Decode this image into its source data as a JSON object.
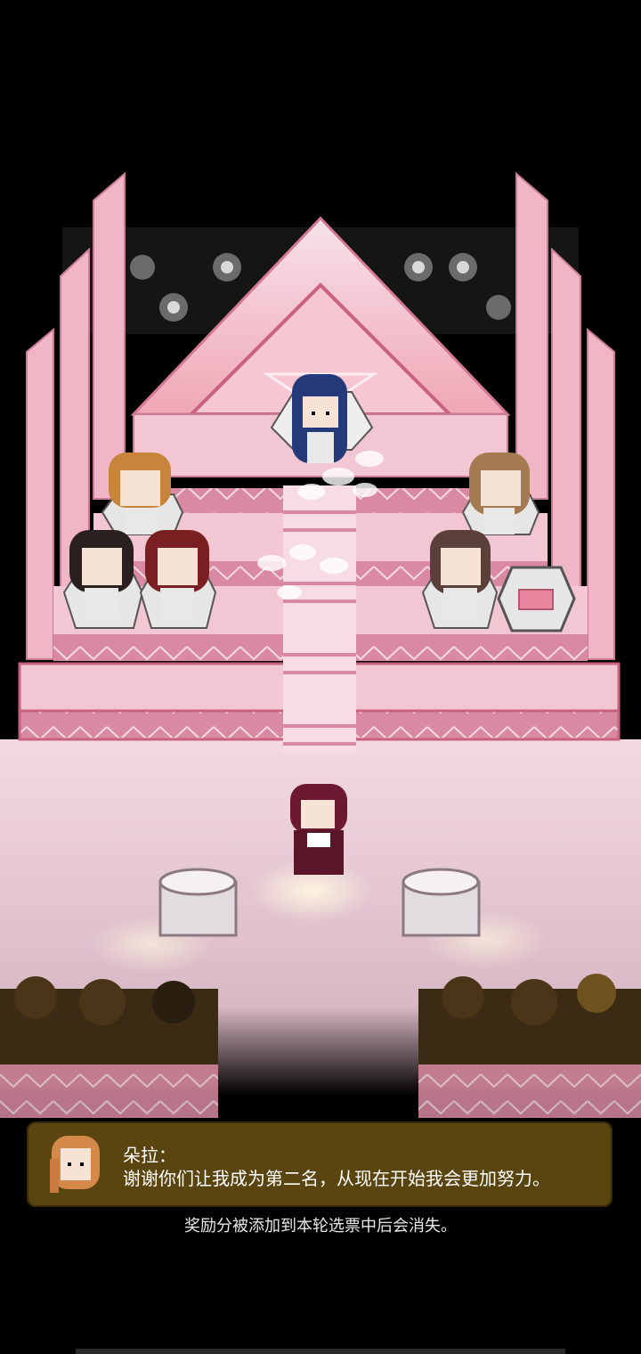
{
  "dialog": {
    "speaker": "朵拉：",
    "message": "谢谢你们让我成为第二名，从现在开始我会更加努力。"
  },
  "hint": "奖励分被添加到本轮选票中后会消失。",
  "colors": {
    "background": "#000000",
    "stage_pink": "#f2c6d3",
    "stage_stripe": "#d9889f",
    "dialog_bg": "#5a4410",
    "text": "#ffffff"
  },
  "icons": {
    "speaker_avatar": "dora-portrait-icon",
    "stage": "pixel-award-stage",
    "light": "spotlight"
  }
}
